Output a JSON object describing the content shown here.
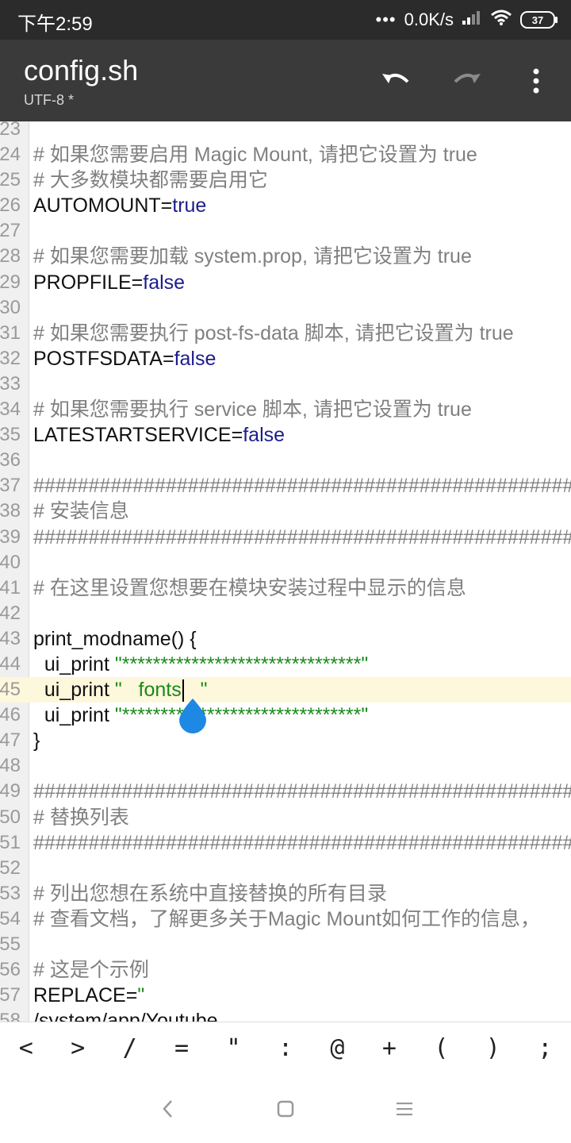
{
  "status_bar": {
    "time": "下午2:59",
    "dots": "•••",
    "speed": "0.0K/s",
    "battery": "37"
  },
  "app_bar": {
    "title": "config.sh",
    "subtitle": "UTF-8 *",
    "icons": [
      "undo-icon",
      "redo-icon",
      "more-vert-icon"
    ]
  },
  "editor": {
    "current_line": 45,
    "lines": [
      {
        "n": "23",
        "segs": []
      },
      {
        "n": "24",
        "segs": [
          {
            "t": "# 如果您需要启用 Magic Mount, 请把它设置为 true",
            "c": "comment"
          }
        ]
      },
      {
        "n": "25",
        "segs": [
          {
            "t": "# 大多数模块都需要启用它",
            "c": "comment"
          }
        ]
      },
      {
        "n": "26",
        "segs": [
          {
            "t": "AUTOMOUNT=",
            "c": "plain"
          },
          {
            "t": "true",
            "c": "kw"
          }
        ]
      },
      {
        "n": "27",
        "segs": []
      },
      {
        "n": "28",
        "segs": [
          {
            "t": "# 如果您需要加载 system.prop, 请把它设置为 true",
            "c": "comment"
          }
        ]
      },
      {
        "n": "29",
        "segs": [
          {
            "t": "PROPFILE=",
            "c": "plain"
          },
          {
            "t": "false",
            "c": "kw"
          }
        ]
      },
      {
        "n": "30",
        "segs": []
      },
      {
        "n": "31",
        "segs": [
          {
            "t": "# 如果您需要执行 post-fs-data 脚本, 请把它设置为 true",
            "c": "comment"
          }
        ]
      },
      {
        "n": "32",
        "segs": [
          {
            "t": "POSTFSDATA=",
            "c": "plain"
          },
          {
            "t": "false",
            "c": "kw"
          }
        ]
      },
      {
        "n": "33",
        "segs": []
      },
      {
        "n": "34",
        "segs": [
          {
            "t": "# 如果您需要执行 service 脚本, 请把它设置为 true",
            "c": "comment"
          }
        ]
      },
      {
        "n": "35",
        "segs": [
          {
            "t": "LATESTARTSERVICE=",
            "c": "plain"
          },
          {
            "t": "false",
            "c": "kw"
          }
        ]
      },
      {
        "n": "36",
        "segs": []
      },
      {
        "n": "37",
        "segs": [
          {
            "t": "##########################################################",
            "c": "comment"
          }
        ]
      },
      {
        "n": "38",
        "segs": [
          {
            "t": "# 安装信息",
            "c": "comment"
          }
        ]
      },
      {
        "n": "39",
        "segs": [
          {
            "t": "##########################################################",
            "c": "comment"
          }
        ]
      },
      {
        "n": "40",
        "segs": []
      },
      {
        "n": "41",
        "segs": [
          {
            "t": "# 在这里设置您想要在模块安装过程中显示的信息",
            "c": "comment"
          }
        ]
      },
      {
        "n": "42",
        "segs": []
      },
      {
        "n": "43",
        "segs": [
          {
            "t": "print_modname() {",
            "c": "plain"
          }
        ]
      },
      {
        "n": "44",
        "segs": [
          {
            "t": "  ui_print ",
            "c": "plain"
          },
          {
            "t": "\"*******************************\"",
            "c": "str"
          }
        ]
      },
      {
        "n": "45",
        "segs": [
          {
            "t": "  ui_print ",
            "c": "plain"
          },
          {
            "t": "\"   fonts",
            "c": "str"
          },
          {
            "t": "",
            "c": "cursor"
          },
          {
            "t": "   \"",
            "c": "str"
          }
        ]
      },
      {
        "n": "46",
        "segs": [
          {
            "t": "  ui_print ",
            "c": "plain"
          },
          {
            "t": "\"*******************************\"",
            "c": "str"
          }
        ]
      },
      {
        "n": "47",
        "segs": [
          {
            "t": "}",
            "c": "plain"
          }
        ]
      },
      {
        "n": "48",
        "segs": []
      },
      {
        "n": "49",
        "segs": [
          {
            "t": "##########################################################",
            "c": "comment"
          }
        ]
      },
      {
        "n": "50",
        "segs": [
          {
            "t": "# 替换列表",
            "c": "comment"
          }
        ]
      },
      {
        "n": "51",
        "segs": [
          {
            "t": "##########################################################",
            "c": "comment"
          }
        ]
      },
      {
        "n": "52",
        "segs": []
      },
      {
        "n": "53",
        "segs": [
          {
            "t": "# 列出您想在系统中直接替换的所有目录",
            "c": "comment"
          }
        ]
      },
      {
        "n": "54",
        "segs": [
          {
            "t": "# 查看文档，了解更多关于Magic Mount如何工作的信息，",
            "c": "comment"
          }
        ]
      },
      {
        "n": "55",
        "segs": []
      },
      {
        "n": "56",
        "segs": [
          {
            "t": "# 这是个示例",
            "c": "comment"
          }
        ]
      },
      {
        "n": "57",
        "segs": [
          {
            "t": "REPLACE=",
            "c": "plain"
          },
          {
            "t": "\"",
            "c": "str"
          }
        ]
      },
      {
        "n": "58",
        "segs": [
          {
            "t": "/system/app/Youtube",
            "c": "plain"
          }
        ]
      }
    ]
  },
  "symbol_bar": {
    "keys": [
      "<",
      ">",
      "/",
      "=",
      "\"",
      ":",
      "@",
      "+",
      "(",
      ")",
      ";"
    ]
  },
  "nav_bar": {
    "icons": [
      "back-icon",
      "home-icon",
      "recents-icon"
    ]
  },
  "colors": {
    "status_bar": "#2b2b2b",
    "app_bar": "#3a3a3a",
    "comment": "#808080",
    "keyword": "#1c1c8c",
    "string": "#1a8a1a",
    "current_line": "#fdf7dc",
    "handle": "#1e88e5"
  }
}
